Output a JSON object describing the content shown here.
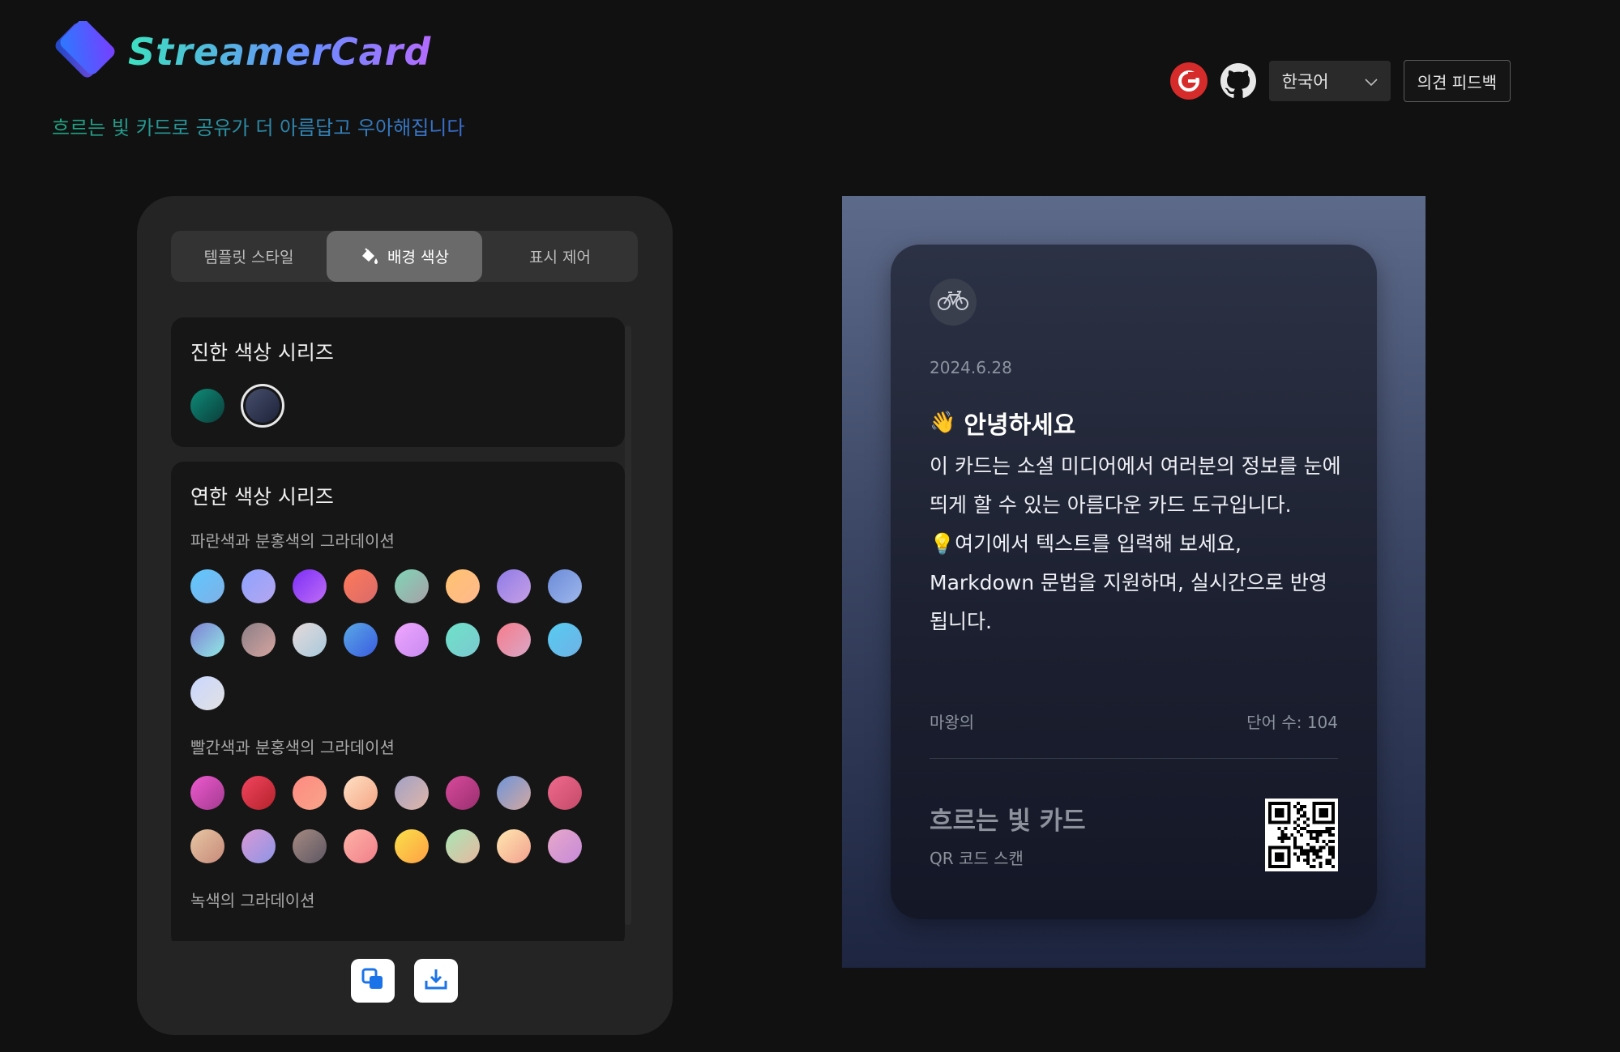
{
  "app": {
    "title": "StreamerCard",
    "tagline": "흐르는 빛 카드로 공유가 더 아름답고 우아해집니다"
  },
  "header": {
    "icons": [
      "gitee-icon",
      "github-icon"
    ],
    "language": "한국어",
    "feedback_label": "의견 피드백"
  },
  "tabs": [
    {
      "label": "템플릿 스타일",
      "active": false
    },
    {
      "label": "배경 색상",
      "active": true,
      "icon": "paint-bucket-icon"
    },
    {
      "label": "표시 제어",
      "active": false
    }
  ],
  "sections": {
    "dark": {
      "title": "진한 색상 시리즈",
      "swatches": [
        {
          "from": "#0e8c78",
          "to": "#0a3d3a"
        },
        {
          "from": "#4a5270",
          "to": "#1a1f35",
          "selected": true
        }
      ]
    },
    "light": {
      "title": "연한 색상 시리즈",
      "groups": [
        {
          "title": "파란색과 분홍색의 그라데이션",
          "swatches": [
            {
              "from": "#5ec8ff",
              "to": "#7fb0e6"
            },
            {
              "from": "#8ea3ff",
              "to": "#b5a6ef"
            },
            {
              "from": "#7b2ff7",
              "to": "#c06cf5"
            },
            {
              "from": "#ff7a5a",
              "to": "#d96a6a"
            },
            {
              "from": "#7fd6b7",
              "to": "#a7a0a7"
            },
            {
              "from": "#ffc371",
              "to": "#ffb88c"
            },
            {
              "from": "#8e7be7",
              "to": "#c7a0e6"
            },
            {
              "from": "#6b8bd8",
              "to": "#9fb7ec"
            },
            {
              "from": "#7f7fd5",
              "to": "#91eae4"
            },
            {
              "from": "#8a7e86",
              "to": "#d6a5a0"
            },
            {
              "from": "#e6dada",
              "to": "#a8c9dc"
            },
            {
              "from": "#5aa9e6",
              "to": "#3a5be0"
            },
            {
              "from": "#f0a6ff",
              "to": "#c78af0"
            },
            {
              "from": "#6ee2c9",
              "to": "#7cc9d0"
            },
            {
              "from": "#f77b8a",
              "to": "#d9a7c7"
            },
            {
              "from": "#56ccf2",
              "to": "#6fb1e5"
            },
            {
              "from": "#c9d6ff",
              "to": "#e2e2e2"
            }
          ]
        },
        {
          "title": "빨간색과 분홍색의 그라데이션",
          "swatches": [
            {
              "from": "#ee5ad0",
              "to": "#a33a8f"
            },
            {
              "from": "#f3455f",
              "to": "#b3222b"
            },
            {
              "from": "#ff8a80",
              "to": "#f7a48a"
            },
            {
              "from": "#ffe0c4",
              "to": "#f4a585"
            },
            {
              "from": "#a1a1c6",
              "to": "#e0b6a8"
            },
            {
              "from": "#d84a9c",
              "to": "#9a2f6f"
            },
            {
              "from": "#6f95d8",
              "to": "#d3a8a0"
            },
            {
              "from": "#f06a8c",
              "to": "#c44a6a"
            },
            {
              "from": "#e7c6a3",
              "to": "#c78a7a"
            },
            {
              "from": "#d89ad6",
              "to": "#8e94e6"
            },
            {
              "from": "#a68a82",
              "to": "#5d5763"
            },
            {
              "from": "#ffb3a7",
              "to": "#f07f8a"
            },
            {
              "from": "#f9e14b",
              "to": "#ff9f43"
            },
            {
              "from": "#a8e6b5",
              "to": "#e6b8a0"
            },
            {
              "from": "#ffe8b0",
              "to": "#f2a08f"
            },
            {
              "from": "#e7a8c9",
              "to": "#c78ad8"
            }
          ]
        },
        {
          "title": "녹색의 그라데이션",
          "swatches": []
        }
      ]
    }
  },
  "actions": [
    "copy-icon",
    "download-icon"
  ],
  "card": {
    "avatar_icon": "bicycle-icon",
    "date": "2024.6.28",
    "heading_emoji": "👋",
    "heading": "안녕하세요",
    "body_line1": "이 카드는 소셜 미디어에서 여러분의 정보를 눈에 띄게 할 수 있는 아름다운 카드 도구입니다.",
    "body_emoji": "💡",
    "body_line2": "여기에서 텍스트를 입력해 보세요, Markdown 문법을 지원하며, 실시간으로 반영됩니다.",
    "author": "마왕의",
    "word_count": "단어 수: 104",
    "footer_title": "흐르는 빛 카드",
    "footer_sub": "QR 코드 스캔"
  },
  "colors": {
    "page_bg": "#111111",
    "panel_bg": "#242424",
    "active_tab": "#6a6a6a",
    "accent_teal": "#3de0c0",
    "accent_purple": "#b36bff",
    "action_blue": "#1a73e8"
  }
}
